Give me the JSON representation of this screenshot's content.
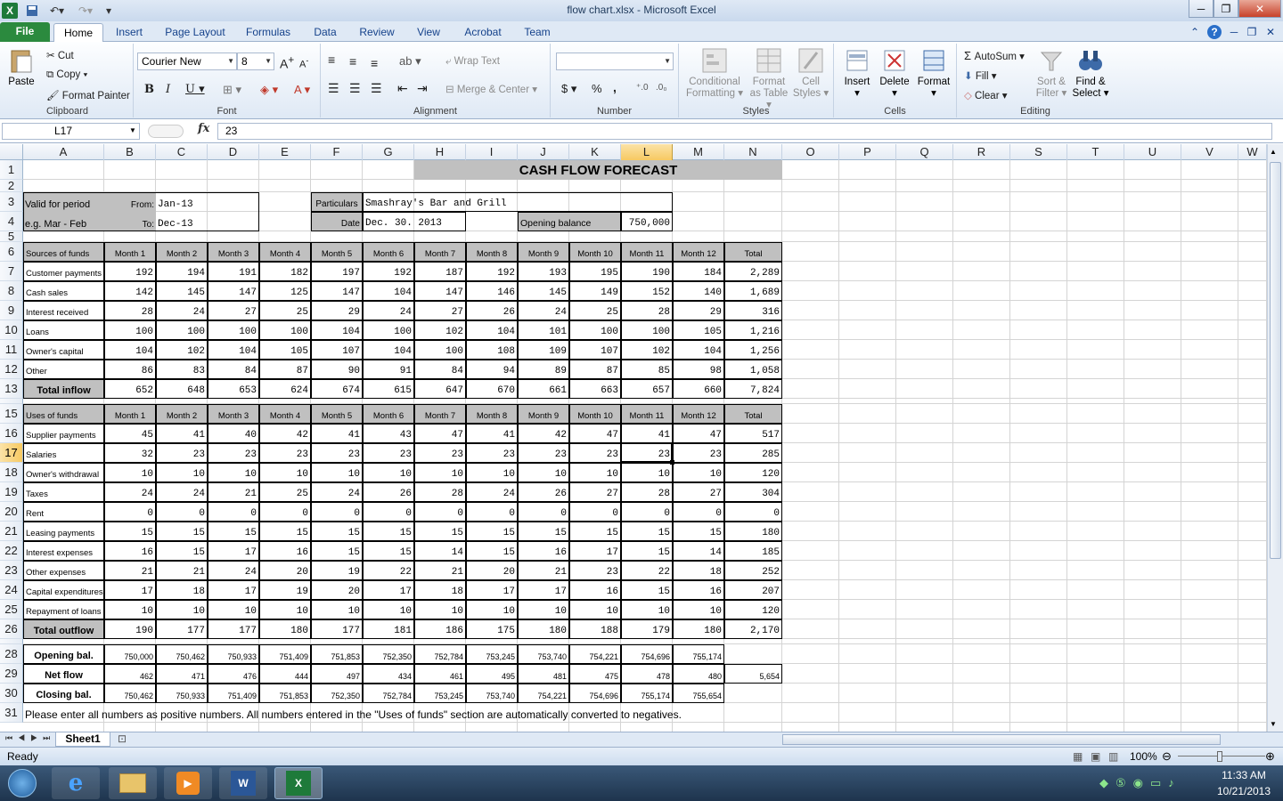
{
  "window": {
    "title": "flow chart.xlsx  -  Microsoft Excel"
  },
  "tabs": [
    "File",
    "Home",
    "Insert",
    "Page Layout",
    "Formulas",
    "Data",
    "Review",
    "View",
    "Acrobat",
    "Team"
  ],
  "ribbon": {
    "clipboard": {
      "label": "Clipboard",
      "paste": "Paste",
      "cut": "Cut",
      "copy": "Copy",
      "format_painter": "Format Painter"
    },
    "font": {
      "label": "Font",
      "name": "Courier New",
      "size": "8"
    },
    "alignment": {
      "label": "Alignment",
      "wrap": "Wrap Text",
      "merge": "Merge & Center"
    },
    "number": {
      "label": "Number",
      "dollar": "$",
      "percent": "%",
      "comma": ","
    },
    "styles": {
      "label": "Styles",
      "cond1": "Conditional",
      "cond2": "Formatting",
      "fmt1": "Format",
      "fmt2": "as Table",
      "cell1": "Cell",
      "cell2": "Styles"
    },
    "cells": {
      "label": "Cells",
      "insert": "Insert",
      "delete": "Delete",
      "format": "Format"
    },
    "editing": {
      "label": "Editing",
      "autosum": "AutoSum",
      "fill": "Fill",
      "clear": "Clear",
      "sort1": "Sort &",
      "sort2": "Filter",
      "find1": "Find &",
      "find2": "Select"
    }
  },
  "formula_bar": {
    "name_box": "L17",
    "fx": "fx",
    "value": "23"
  },
  "columns": [
    "A",
    "B",
    "C",
    "D",
    "E",
    "F",
    "G",
    "H",
    "I",
    "J",
    "K",
    "L",
    "M",
    "N",
    "O",
    "P",
    "Q",
    "R",
    "S",
    "T",
    "U",
    "V",
    "W"
  ],
  "selected_col": "L",
  "selected_row": "17",
  "sheet": {
    "title": "CASH FLOW FORECAST",
    "valid_for_period": "Valid for period",
    "from_label": "From:",
    "from_value": "Jan-13",
    "eg": "e.g. Mar - Feb",
    "to_label": "To:",
    "to_value": "Dec-13",
    "particulars_label": "Particulars",
    "particulars_value": "Smashray's Bar and Grill",
    "date_label": "Date",
    "date_value": "Dec. 30. 2013",
    "opening_label": "Opening balance",
    "opening_value": "750,000",
    "months": [
      "Month 1",
      "Month 2",
      "Month 3",
      "Month 4",
      "Month 5",
      "Month 6",
      "Month 7",
      "Month 8",
      "Month 9",
      "Month 10",
      "Month 11",
      "Month 12"
    ],
    "total_label": "Total",
    "sources_header": "Sources of funds",
    "sources": [
      {
        "label": "Customer payments",
        "values": [
          "192",
          "194",
          "191",
          "182",
          "197",
          "192",
          "187",
          "192",
          "193",
          "195",
          "190",
          "184"
        ],
        "total": "2,289"
      },
      {
        "label": "Cash sales",
        "values": [
          "142",
          "145",
          "147",
          "125",
          "147",
          "104",
          "147",
          "146",
          "145",
          "149",
          "152",
          "140"
        ],
        "total": "1,689"
      },
      {
        "label": "Interest received",
        "values": [
          "28",
          "24",
          "27",
          "25",
          "29",
          "24",
          "27",
          "26",
          "24",
          "25",
          "28",
          "29"
        ],
        "total": "316"
      },
      {
        "label": "Loans",
        "values": [
          "100",
          "100",
          "100",
          "100",
          "104",
          "100",
          "102",
          "104",
          "101",
          "100",
          "100",
          "105"
        ],
        "total": "1,216"
      },
      {
        "label": "Owner's capital",
        "values": [
          "104",
          "102",
          "104",
          "105",
          "107",
          "104",
          "100",
          "108",
          "109",
          "107",
          "102",
          "104"
        ],
        "total": "1,256"
      },
      {
        "label": "Other",
        "values": [
          "86",
          "83",
          "84",
          "87",
          "90",
          "91",
          "84",
          "94",
          "89",
          "87",
          "85",
          "98"
        ],
        "total": "1,058"
      }
    ],
    "total_inflow": {
      "label": "Total inflow",
      "values": [
        "652",
        "648",
        "653",
        "624",
        "674",
        "615",
        "647",
        "670",
        "661",
        "663",
        "657",
        "660"
      ],
      "total": "7,824"
    },
    "uses_header": "Uses of funds",
    "uses": [
      {
        "label": "Supplier payments",
        "values": [
          "45",
          "41",
          "40",
          "42",
          "41",
          "43",
          "47",
          "41",
          "42",
          "47",
          "41",
          "47"
        ],
        "total": "517"
      },
      {
        "label": "Salaries",
        "values": [
          "32",
          "23",
          "23",
          "23",
          "23",
          "23",
          "23",
          "23",
          "23",
          "23",
          "23",
          "23"
        ],
        "total": "285"
      },
      {
        "label": "Owner's withdrawal",
        "values": [
          "10",
          "10",
          "10",
          "10",
          "10",
          "10",
          "10",
          "10",
          "10",
          "10",
          "10",
          "10"
        ],
        "total": "120"
      },
      {
        "label": "Taxes",
        "values": [
          "24",
          "24",
          "21",
          "25",
          "24",
          "26",
          "28",
          "24",
          "26",
          "27",
          "28",
          "27"
        ],
        "total": "304"
      },
      {
        "label": "Rent",
        "values": [
          "0",
          "0",
          "0",
          "0",
          "0",
          "0",
          "0",
          "0",
          "0",
          "0",
          "0",
          "0"
        ],
        "total": "0"
      },
      {
        "label": "Leasing payments",
        "values": [
          "15",
          "15",
          "15",
          "15",
          "15",
          "15",
          "15",
          "15",
          "15",
          "15",
          "15",
          "15"
        ],
        "total": "180"
      },
      {
        "label": "Interest expenses",
        "values": [
          "16",
          "15",
          "17",
          "16",
          "15",
          "15",
          "14",
          "15",
          "16",
          "17",
          "15",
          "14"
        ],
        "total": "185"
      },
      {
        "label": "Other expenses",
        "values": [
          "21",
          "21",
          "24",
          "20",
          "19",
          "22",
          "21",
          "20",
          "21",
          "23",
          "22",
          "18"
        ],
        "total": "252"
      },
      {
        "label": "Capital expenditures",
        "values": [
          "17",
          "18",
          "17",
          "19",
          "20",
          "17",
          "18",
          "17",
          "17",
          "16",
          "15",
          "16"
        ],
        "total": "207"
      },
      {
        "label": "Repayment of loans",
        "values": [
          "10",
          "10",
          "10",
          "10",
          "10",
          "10",
          "10",
          "10",
          "10",
          "10",
          "10",
          "10"
        ],
        "total": "120"
      }
    ],
    "total_outflow": {
      "label": "Total outflow",
      "values": [
        "190",
        "177",
        "177",
        "180",
        "177",
        "181",
        "186",
        "175",
        "180",
        "188",
        "179",
        "180"
      ],
      "total": "2,170"
    },
    "opening_bal": {
      "label": "Opening bal.",
      "values": [
        "750,000",
        "750,462",
        "750,933",
        "751,409",
        "751,853",
        "752,350",
        "752,784",
        "753,245",
        "753,740",
        "754,221",
        "754,696",
        "755,174"
      ]
    },
    "net_flow": {
      "label": "Net flow",
      "values": [
        "462",
        "471",
        "476",
        "444",
        "497",
        "434",
        "461",
        "495",
        "481",
        "475",
        "478",
        "480"
      ],
      "total": "5,654"
    },
    "closing_bal": {
      "label": "Closing bal.",
      "values": [
        "750,462",
        "750,933",
        "751,409",
        "751,853",
        "752,350",
        "752,784",
        "753,245",
        "753,740",
        "754,221",
        "754,696",
        "755,174",
        "755,654"
      ]
    },
    "note": "Please enter all numbers as positive numbers. All numbers entered in the \"Uses of funds\" section are automatically converted to negatives."
  },
  "sheet_tab": "Sheet1",
  "status": {
    "ready": "Ready",
    "zoom": "100%"
  },
  "taskbar": {
    "time": "11:33 AM",
    "date": "10/21/2013"
  }
}
